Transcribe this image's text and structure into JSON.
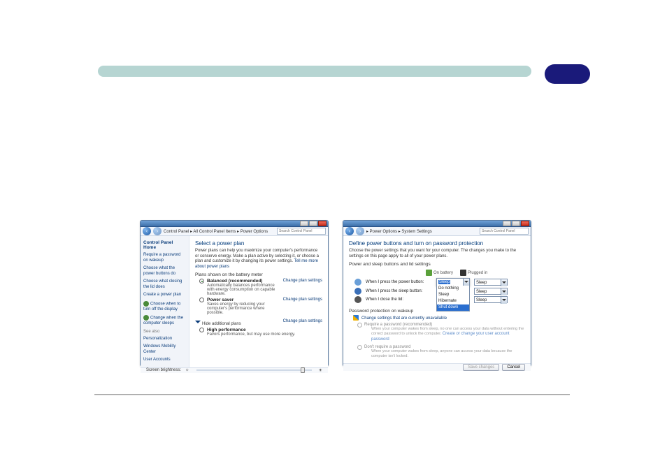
{
  "colors": {
    "accent": "#0a3c7a",
    "headerBlue": "#1a1a7a",
    "pill": "#b6d5d2"
  },
  "left_window": {
    "title_buttons": [
      "minimize",
      "maximize",
      "close"
    ],
    "breadcrumb": "Control Panel  ▸  All Control Panel Items  ▸  Power Options",
    "search_placeholder": "Search Control Panel",
    "sidebar": {
      "header": "Control Panel Home",
      "links": [
        "Require a password on wakeup",
        "Choose what the power buttons do",
        "Choose what closing the lid does",
        "Create a power plan",
        "Choose when to turn off the display",
        "Change when the computer sleeps"
      ],
      "see_also_label": "See also",
      "see_also": [
        "Personalization",
        "Windows Mobility Center",
        "User Accounts"
      ]
    },
    "content": {
      "heading": "Select a power plan",
      "desc": "Power plans can help you maximize your computer's performance or conserve energy. Make a plan active by selecting it, or choose a plan and customize it by changing its power settings.",
      "desc_link": "Tell me more about power plans",
      "section_label": "Plans shown on the battery meter",
      "plans": [
        {
          "name": "Balanced (recommended)",
          "detail": "Automatically balances performance with energy consumption on capable hardware.",
          "selected": true,
          "change_link": "Change plan settings"
        },
        {
          "name": "Power saver",
          "detail": "Saves energy by reducing your computer's performance where possible.",
          "selected": false,
          "change_link": "Change plan settings"
        }
      ],
      "hide_label": "Hide additional plans",
      "hide_link": "Change plan settings",
      "extra_plan": {
        "name": "High performance",
        "detail": "Favors performance, but may use more energy.",
        "selected": false
      },
      "footer_label": "Screen brightness:"
    }
  },
  "right_window": {
    "title_buttons": [
      "minimize",
      "maximize",
      "close"
    ],
    "breadcrumb": "▸  Power Options  ▸  System Settings",
    "search_placeholder": "Search Control Panel",
    "content": {
      "heading": "Define power buttons and turn on password protection",
      "desc": "Choose the power settings that you want for your computer. The changes you make to the settings on this page apply to all of your power plans.",
      "section1": "Power and sleep buttons and lid settings",
      "col_headers": [
        "On battery",
        "Plugged in"
      ],
      "rows": [
        {
          "label": "When I press the power button:",
          "battery": "Sleep",
          "plugged": "Sleep"
        },
        {
          "label": "When I press the sleep button:",
          "battery": "Sleep",
          "plugged": "Sleep"
        },
        {
          "label": "When I close the lid:",
          "battery": "Sleep",
          "plugged": "Sleep"
        }
      ],
      "dropdown_options": [
        "Do nothing",
        "Sleep",
        "Hibernate",
        "Shut down"
      ],
      "section2": "Password protection on wakeup",
      "change_unavailable": "Change settings that are currently unavailable",
      "pw_options": [
        {
          "label": "Require a password (recommended)",
          "detail": "When your computer wakes from sleep, no one can access your data without entering the correct password to unlock the computer.",
          "link": "Create or change your user account password"
        },
        {
          "label": "Don't require a password",
          "detail": "When your computer wakes from sleep, anyone can access your data because the computer isn't locked."
        }
      ],
      "buttons": {
        "save": "Save changes",
        "cancel": "Cancel"
      }
    }
  }
}
